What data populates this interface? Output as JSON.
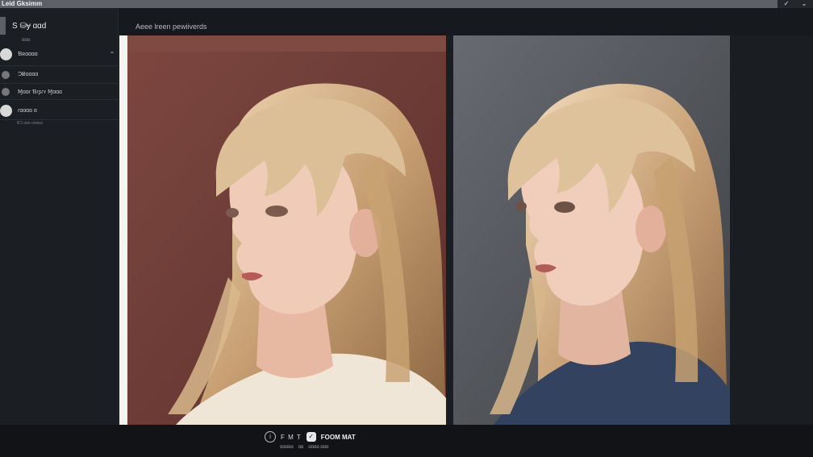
{
  "window": {
    "title": "Leid Gksimm",
    "controls": [
      "✓",
      "⌄"
    ]
  },
  "sidebar": {
    "header": "S ⛁ɏ ɑɑd",
    "tag": "ɑɑɑ",
    "items": [
      {
        "label": "Ɓʀɑɑɑɑ",
        "chev": "⌃"
      },
      {
        "label": "ƆɃɑɑɑɑ"
      },
      {
        "label": "Ɱɑɑɾ Ɓɾʂɾʏ Ɱɑɑɑ"
      },
      {
        "label": "ɾɑɑɑɑ ɑ"
      }
    ],
    "sub": "ɃƆ ɑɑɑ ɑɑɑɑɑ"
  },
  "main": {
    "title": "Aeee lreen pewiiverds"
  },
  "bottom": {
    "icon1": "i",
    "text1": "F M T",
    "icon2": "✓",
    "text2": "FOOM MAT",
    "row2": [
      "ɑɑɑɑɑ",
      "ɑɑ",
      "ɑɑɑɑ ɑɑɑ"
    ]
  },
  "colors": {
    "panel_left_bg": "#6f3c36",
    "panel_right_bg": "#5b5d62",
    "hair": "#d3b48c",
    "skin": "#f0cbb8",
    "sweater_left": "#efe6d8",
    "sweater_right": "#33425f"
  }
}
